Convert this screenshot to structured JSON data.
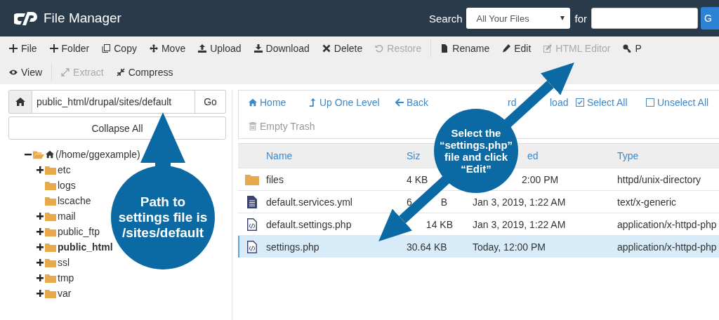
{
  "header": {
    "title": "File Manager",
    "search_label": "Search",
    "search_scope": "All Your Files",
    "for_label": "for",
    "search_button": "G"
  },
  "toolbar_rows": [
    [
      {
        "label": "File",
        "disabled": false
      },
      {
        "label": "Folder",
        "disabled": false
      },
      {
        "label": "Copy",
        "disabled": false
      },
      {
        "label": "Move",
        "disabled": false
      },
      {
        "label": "Upload",
        "disabled": false
      },
      {
        "label": "Download",
        "disabled": false
      },
      {
        "label": "Delete",
        "disabled": false
      },
      {
        "label": "Restore",
        "disabled": true
      },
      {
        "label": "Rename",
        "disabled": false
      },
      {
        "label": "Edit",
        "disabled": false
      },
      {
        "label": "HTML Editor",
        "disabled": true
      },
      {
        "label": "P",
        "disabled": false
      }
    ],
    [
      {
        "label": "View",
        "disabled": false
      },
      {
        "label": "Extract",
        "disabled": true
      },
      {
        "label": "Compress",
        "disabled": false
      }
    ]
  ],
  "path_bar": {
    "value": "public_html/drupal/sites/default",
    "go": "Go"
  },
  "collapse_button": "Collapse All",
  "tree": [
    {
      "label": "(/home/ggexample)",
      "expanded": true,
      "leaf": false,
      "selected": false,
      "children": [
        {
          "label": "etc",
          "expanded": false,
          "leaf": false,
          "selected": false
        },
        {
          "label": "logs",
          "expanded": false,
          "leaf": true,
          "selected": false
        },
        {
          "label": "lscache",
          "expanded": false,
          "leaf": true,
          "selected": false
        },
        {
          "label": "mail",
          "expanded": false,
          "leaf": false,
          "selected": false
        },
        {
          "label": "public_ftp",
          "expanded": false,
          "leaf": false,
          "selected": false
        },
        {
          "label": "public_html",
          "expanded": false,
          "leaf": false,
          "selected": true
        },
        {
          "label": "ssl",
          "expanded": false,
          "leaf": false,
          "selected": false
        },
        {
          "label": "tmp",
          "expanded": false,
          "leaf": false,
          "selected": false
        },
        {
          "label": "var",
          "expanded": false,
          "leaf": false,
          "selected": false
        }
      ]
    }
  ],
  "nav_toolbar": [
    [
      {
        "label": "Home",
        "cut": false,
        "disabled": false
      },
      {
        "label": "Up One Level",
        "cut": false,
        "disabled": false
      },
      {
        "label": "Back",
        "cut": false,
        "disabled": false
      },
      {
        "label": "rd",
        "cut": true,
        "disabled": false
      },
      {
        "label": "load",
        "cut": true,
        "disabled": false
      },
      {
        "label": "Select All",
        "cut": false,
        "disabled": false
      },
      {
        "label": "Unselect All",
        "cut": false,
        "disabled": false
      }
    ],
    [
      {
        "label": "Empty Trash",
        "cut": false,
        "disabled": true
      }
    ]
  ],
  "table": {
    "columns": [
      {
        "label": "Name",
        "cut": false
      },
      {
        "label": "Siz",
        "cut": false
      },
      {
        "label": "ed",
        "cut": true
      },
      {
        "label": "Type",
        "cut": false
      }
    ],
    "rows": [
      {
        "kind": "folder",
        "name": "files",
        "size": [
          "4 KB"
        ],
        "size_cut": false,
        "modified": "2:00 PM",
        "modified_cut": true,
        "type": "httpd/unix-directory",
        "selected": false
      },
      {
        "kind": "text",
        "name": "default.services.yml",
        "size": [
          "6",
          "B"
        ],
        "size_cut": false,
        "modified": "Jan 3, 2019, 1:22 AM",
        "type": "text/x-generic",
        "selected": false
      },
      {
        "kind": "code",
        "name": "default.settings.php",
        "size": [
          "14 KB"
        ],
        "size_cut": true,
        "modified": "Jan 3, 2019, 1:22 AM",
        "modified_cut": false,
        "type": "application/x-httpd-php",
        "selected": false
      },
      {
        "kind": "code",
        "name": "settings.php",
        "size": [
          "30.64 KB"
        ],
        "size_cut": false,
        "modified": "Today, 12:00 PM",
        "modified_cut": false,
        "type": "application/x-httpd-php",
        "selected": true
      }
    ]
  },
  "callouts": [
    "Path to\nsettings file is\n/sites/default",
    "Select the\n“settings.php”\nfile and click\n“Edit”"
  ]
}
